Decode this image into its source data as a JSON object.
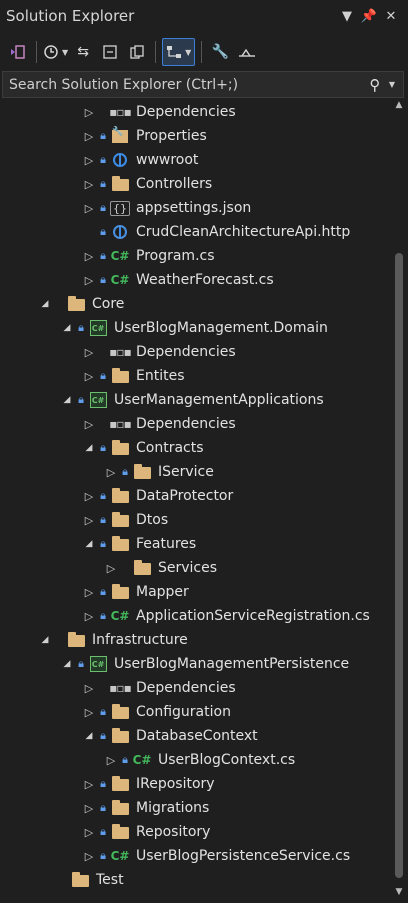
{
  "window": {
    "title": "Solution Explorer",
    "controls": [
      "▼",
      "📌",
      "✕"
    ]
  },
  "search": {
    "placeholder": "Search Solution Explorer (Ctrl+;)"
  },
  "colors": {
    "background": "#1f1f1f",
    "folder": "#dcb67a",
    "csharp": "#43b85b",
    "accent": "#3a80d8"
  },
  "tree": [
    {
      "indent": 3,
      "exp": "right",
      "lock": false,
      "icon": "dependencies-icon",
      "label": "Dependencies"
    },
    {
      "indent": 3,
      "exp": "right",
      "lock": true,
      "icon": "properties-icon",
      "label": "Properties"
    },
    {
      "indent": 3,
      "exp": "right",
      "lock": true,
      "icon": "globe-icon",
      "label": "wwwroot"
    },
    {
      "indent": 3,
      "exp": "right",
      "lock": true,
      "icon": "folder-icon",
      "label": "Controllers"
    },
    {
      "indent": 3,
      "exp": "right",
      "lock": true,
      "icon": "json-file-icon",
      "label": "appsettings.json"
    },
    {
      "indent": 3,
      "exp": "none",
      "lock": true,
      "icon": "http-file-icon",
      "label": "CrudCleanArchitectureApi.http"
    },
    {
      "indent": 3,
      "exp": "right",
      "lock": true,
      "icon": "csharp-file-icon",
      "label": "Program.cs"
    },
    {
      "indent": 3,
      "exp": "right",
      "lock": true,
      "icon": "csharp-file-icon",
      "label": "WeatherForecast.cs"
    },
    {
      "indent": 1,
      "exp": "down",
      "lock": false,
      "icon": "folder-icon",
      "label": "Core"
    },
    {
      "indent": 2,
      "exp": "down",
      "lock": true,
      "icon": "project-icon",
      "label": "UserBlogManagement.Domain"
    },
    {
      "indent": 3,
      "exp": "right",
      "lock": false,
      "icon": "dependencies-icon",
      "label": "Dependencies"
    },
    {
      "indent": 3,
      "exp": "right",
      "lock": true,
      "icon": "folder-icon",
      "label": "Entites"
    },
    {
      "indent": 2,
      "exp": "down",
      "lock": true,
      "icon": "project-icon",
      "label": "UserManagementApplications"
    },
    {
      "indent": 3,
      "exp": "right",
      "lock": false,
      "icon": "dependencies-icon",
      "label": "Dependencies"
    },
    {
      "indent": 3,
      "exp": "down",
      "lock": true,
      "icon": "folder-icon",
      "label": "Contracts"
    },
    {
      "indent": 4,
      "exp": "right",
      "lock": true,
      "icon": "folder-icon",
      "label": "IService"
    },
    {
      "indent": 3,
      "exp": "right",
      "lock": true,
      "icon": "folder-icon",
      "label": "DataProtector"
    },
    {
      "indent": 3,
      "exp": "right",
      "lock": true,
      "icon": "folder-icon",
      "label": "Dtos"
    },
    {
      "indent": 3,
      "exp": "down",
      "lock": true,
      "icon": "folder-icon",
      "label": "Features"
    },
    {
      "indent": 4,
      "exp": "right",
      "lock": false,
      "icon": "folder-icon",
      "label": "Services"
    },
    {
      "indent": 3,
      "exp": "right",
      "lock": true,
      "icon": "folder-icon",
      "label": "Mapper"
    },
    {
      "indent": 3,
      "exp": "right",
      "lock": true,
      "icon": "csharp-file-icon",
      "label": "ApplicationServiceRegistration.cs"
    },
    {
      "indent": 1,
      "exp": "down",
      "lock": false,
      "icon": "folder-icon",
      "label": "Infrastructure"
    },
    {
      "indent": 2,
      "exp": "down",
      "lock": true,
      "icon": "project-icon",
      "label": "UserBlogManagementPersistence"
    },
    {
      "indent": 3,
      "exp": "right",
      "lock": false,
      "icon": "dependencies-icon",
      "label": "Dependencies"
    },
    {
      "indent": 3,
      "exp": "right",
      "lock": true,
      "icon": "folder-icon",
      "label": "Configuration"
    },
    {
      "indent": 3,
      "exp": "down",
      "lock": true,
      "icon": "folder-icon",
      "label": "DatabaseContext"
    },
    {
      "indent": 4,
      "exp": "right",
      "lock": true,
      "icon": "csharp-file-icon",
      "label": "UserBlogContext.cs"
    },
    {
      "indent": 3,
      "exp": "right",
      "lock": true,
      "icon": "folder-icon",
      "label": "IRepository"
    },
    {
      "indent": 3,
      "exp": "right",
      "lock": true,
      "icon": "folder-icon",
      "label": "Migrations"
    },
    {
      "indent": 3,
      "exp": "right",
      "lock": true,
      "icon": "folder-icon",
      "label": "Repository"
    },
    {
      "indent": 3,
      "exp": "right",
      "lock": true,
      "icon": "csharp-file-icon",
      "label": "UserBlogPersistenceService.cs"
    },
    {
      "indent": 0,
      "exp": "none",
      "lock": false,
      "icon": "folder-icon",
      "label": "Test"
    }
  ]
}
